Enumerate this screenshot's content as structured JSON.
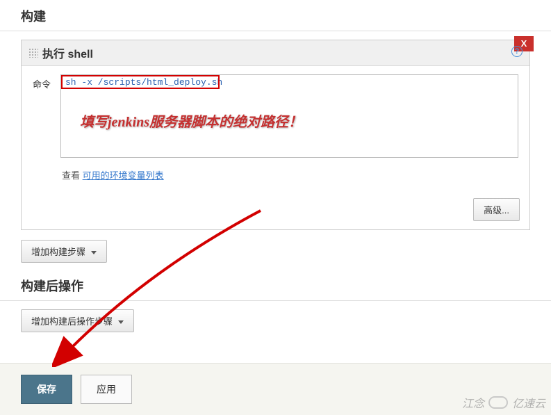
{
  "sections": {
    "build_title": "构建",
    "post_build_title": "构建后操作"
  },
  "shell": {
    "header": "执行 shell",
    "close_label": "X",
    "cmd_label": "命令",
    "cmd_value": "sh -x /scripts/html_deploy.sh",
    "annotation": "填写jenkins服务器脚本的绝对路径！",
    "env_prefix": "查看 ",
    "env_link": "可用的环境变量列表",
    "advanced_label": "高级..."
  },
  "buttons": {
    "add_build_step": "增加构建步骤",
    "add_post_build": "增加构建后操作步骤",
    "save": "保存",
    "apply": "应用"
  },
  "watermark": {
    "text_left": "江念",
    "text_right": "亿速云"
  }
}
